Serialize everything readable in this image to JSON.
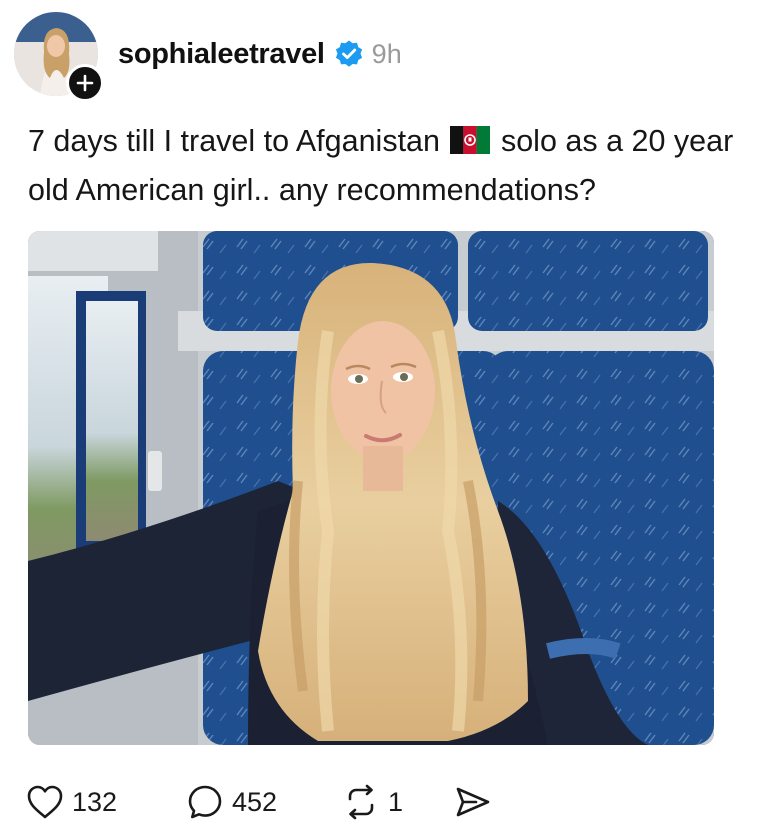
{
  "post": {
    "username": "sophialeetravel",
    "timestamp": "9h",
    "verified_icon": "verified-badge-icon",
    "follow_icon": "plus-icon",
    "caption_before_flag": "7 days till I travel to Afganistan",
    "flag_icon": "afghanistan-flag-icon",
    "caption_after_flag": "solo as a 20 year old American girl.. any recommendations?",
    "photo_icon": "selfie-photo"
  },
  "actions": {
    "like_icon": "heart-icon",
    "likes": "132",
    "reply_icon": "comment-icon",
    "replies": "452",
    "repost_icon": "repost-icon",
    "reposts": "1",
    "share_icon": "send-icon"
  },
  "colors": {
    "verified": "#1d9bf0",
    "timestamp": "#9a9a9a",
    "text": "#111111",
    "seat_blue": "#1f4f8e"
  }
}
